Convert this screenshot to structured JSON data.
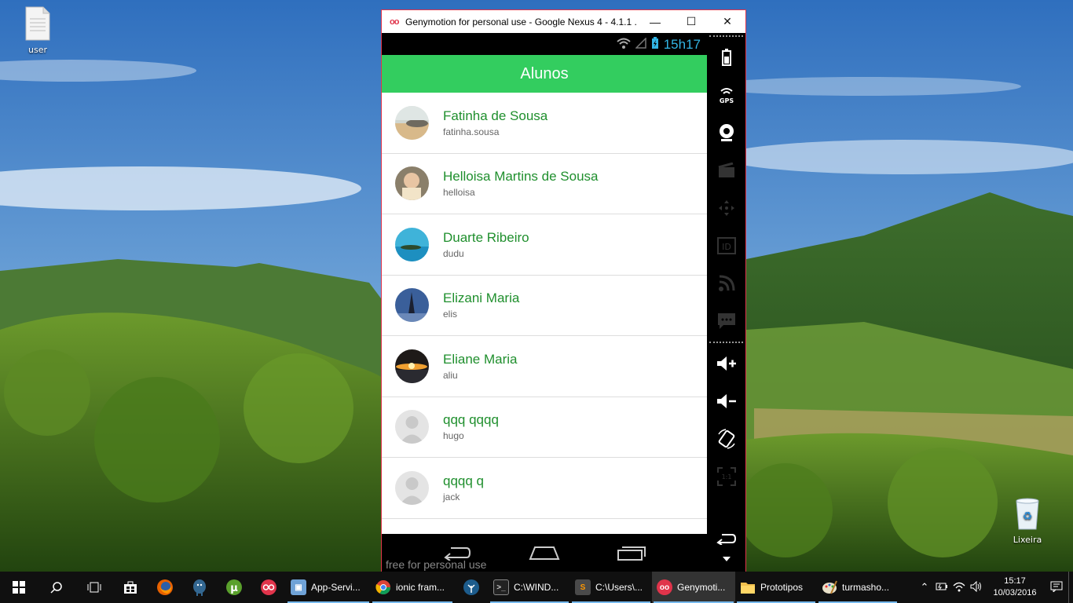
{
  "desktop": {
    "icons": [
      {
        "label": "user"
      },
      {
        "label": "Lixeira"
      }
    ]
  },
  "window": {
    "title": "Genymotion for personal use - Google Nexus 4 - 4.1.1 ...",
    "accent": "#e0344b"
  },
  "phone": {
    "status_time": "15h17",
    "app_title": "Alunos",
    "header_color": "#33cd5f",
    "students": [
      {
        "name": "Fatinha de Sousa",
        "username": "fatinha.sousa",
        "avatar": "beach-photo"
      },
      {
        "name": "Helloisa Martins de Sousa",
        "username": "helloisa",
        "avatar": "baby-photo"
      },
      {
        "name": "Duarte Ribeiro",
        "username": "dudu",
        "avatar": "island-photo"
      },
      {
        "name": "Elizani Maria",
        "username": "elis",
        "avatar": "eiffel-photo"
      },
      {
        "name": "Eliane Maria",
        "username": "aliu",
        "avatar": "sunset-photo"
      },
      {
        "name": "qqq qqqq",
        "username": "hugo",
        "avatar": "default-person"
      },
      {
        "name": "qqqq q",
        "username": "jack",
        "avatar": "default-person"
      }
    ],
    "watermark": "free for personal use"
  },
  "sidebar": {
    "buttons": [
      "battery-icon",
      "gps-icon",
      "webcam-icon",
      "screencast-icon",
      "dpad-icon",
      "id-icon",
      "rss-icon",
      "sms-icon",
      "volume-up-icon",
      "volume-down-icon",
      "rotate-icon",
      "pixel-perfect-icon",
      "back-icon",
      "menu-down-icon"
    ]
  },
  "taskbar": {
    "apps": [
      {
        "label": "App-Servi..."
      },
      {
        "label": "ionic fram..."
      },
      {
        "label": "C:\\WIND..."
      },
      {
        "label": "C:\\Users\\..."
      },
      {
        "label": "Genymoti..."
      },
      {
        "label": "Prototipos"
      },
      {
        "label": "turmasho..."
      }
    ],
    "clock_time": "15:17",
    "clock_date": "10/03/2016"
  }
}
